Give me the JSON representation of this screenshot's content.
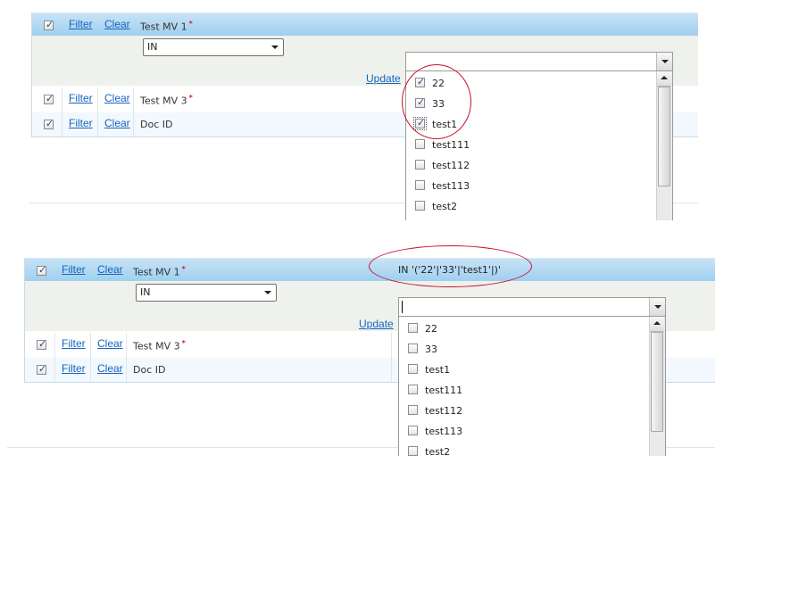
{
  "panel1": {
    "header_row": {
      "checked": true,
      "filter_label": "Filter",
      "clear_label": "Clear",
      "field_label": "Test MV 1",
      "required_mark": "*"
    },
    "operator": {
      "value": "IN"
    },
    "update_label": "Update",
    "rows": [
      {
        "checked": true,
        "filter_label": "Filter",
        "clear_label": "Clear",
        "field_label": "Test MV 3",
        "required_mark": "*"
      },
      {
        "checked": true,
        "filter_label": "Filter",
        "clear_label": "Clear",
        "field_label": "Doc ID"
      }
    ],
    "combo_value": "",
    "dropdown_items": [
      {
        "label": "22",
        "checked": true
      },
      {
        "label": "33",
        "checked": true
      },
      {
        "label": "test1",
        "checked": true
      },
      {
        "label": "test111",
        "checked": false
      },
      {
        "label": "test112",
        "checked": false
      },
      {
        "label": "test113",
        "checked": false
      },
      {
        "label": "test2",
        "checked": false
      }
    ]
  },
  "panel2": {
    "header_row": {
      "checked": true,
      "filter_label": "Filter",
      "clear_label": "Clear",
      "field_label": "Test MV 1",
      "required_mark": "*"
    },
    "summary": "IN '('22'|'33'|'test1'|)'",
    "operator": {
      "value": "IN"
    },
    "update_label": "Update",
    "rows": [
      {
        "checked": true,
        "filter_label": "Filter",
        "clear_label": "Clear",
        "field_label": "Test MV 3",
        "required_mark": "*"
      },
      {
        "checked": true,
        "filter_label": "Filter",
        "clear_label": "Clear",
        "field_label": "Doc ID"
      }
    ],
    "combo_value": "",
    "dropdown_items": [
      {
        "label": "22",
        "checked": false
      },
      {
        "label": "33",
        "checked": false
      },
      {
        "label": "test1",
        "checked": false
      },
      {
        "label": "test111",
        "checked": false
      },
      {
        "label": "test112",
        "checked": false
      },
      {
        "label": "test113",
        "checked": false
      },
      {
        "label": "test2",
        "checked": false
      }
    ]
  },
  "colors": {
    "header_gradient_top": "#c9e3f6",
    "header_gradient_bottom": "#9fd0ef",
    "link": "#1565c0",
    "annotation": "#c8102e"
  }
}
